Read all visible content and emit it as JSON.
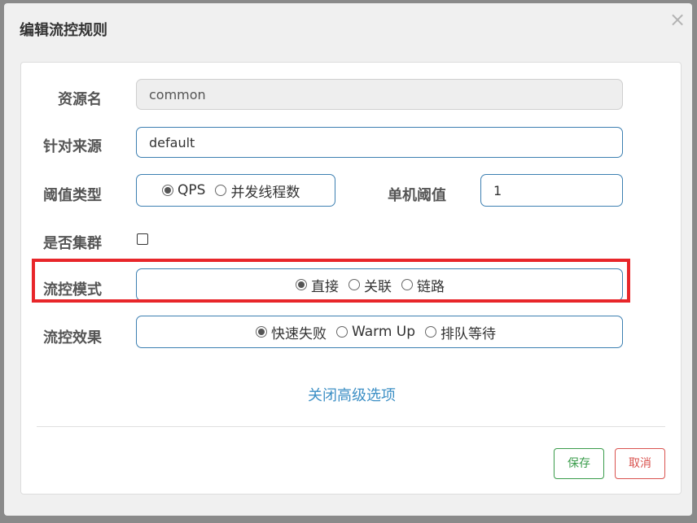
{
  "dialog": {
    "title": "编辑流控规则",
    "close_glyph": "×"
  },
  "form": {
    "resource_label": "资源名",
    "resource_value": "common",
    "source_label": "针对来源",
    "source_value": "default",
    "threshold_type_label": "阈值类型",
    "threshold_type_options": [
      "QPS",
      "并发线程数"
    ],
    "threshold_type_selected": "QPS",
    "single_threshold_label": "单机阈值",
    "single_threshold_value": "1",
    "cluster_label": "是否集群",
    "cluster_checked": false,
    "mode_label": "流控模式",
    "mode_options": [
      "直接",
      "关联",
      "链路"
    ],
    "mode_selected": "直接",
    "effect_label": "流控效果",
    "effect_options": [
      "快速失败",
      "Warm Up",
      "排队等待"
    ],
    "effect_selected": "快速失败",
    "advanced_toggle_label": "关闭高级选项"
  },
  "footer": {
    "save_label": "保存",
    "cancel_label": "取消"
  },
  "colors": {
    "highlight_border": "#e8262a",
    "input_border": "#3c7fb1",
    "save": "#3a9c4b",
    "cancel": "#d9534f",
    "link": "#3c8fc5"
  }
}
